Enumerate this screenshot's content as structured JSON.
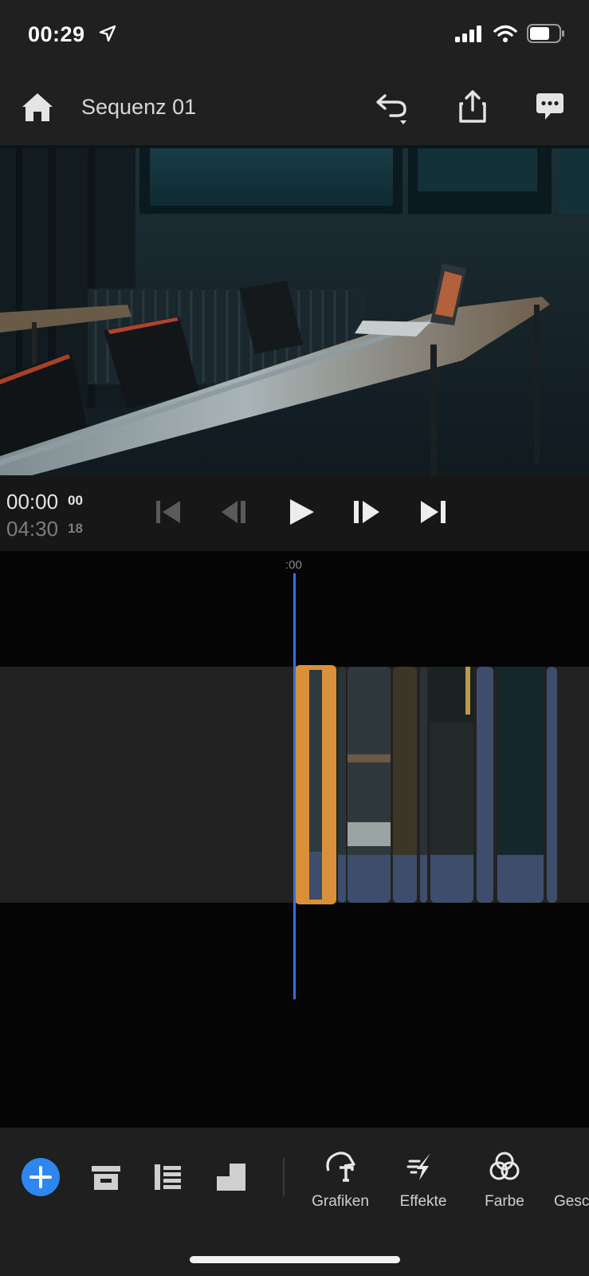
{
  "status_bar": {
    "time": "00:29"
  },
  "header": {
    "title": "Sequenz 01"
  },
  "transport": {
    "current_time": "00:00",
    "current_frames": "00",
    "duration": "04:30",
    "duration_frames": "18"
  },
  "timeline": {
    "ruler_label": ":00"
  },
  "toolbar": {
    "tools": [
      {
        "label": "Grafiken",
        "icon": "graphics-icon"
      },
      {
        "label": "Effekte",
        "icon": "effects-icon"
      },
      {
        "label": "Farbe",
        "icon": "color-icon"
      },
      {
        "label": "Gesc",
        "icon": "speed-icon"
      }
    ]
  },
  "colors": {
    "accent_blue": "#2f86ee",
    "playhead": "#3a6fe0",
    "selected_clip": "#d9903b",
    "audio_track": "#3e4d6b"
  }
}
